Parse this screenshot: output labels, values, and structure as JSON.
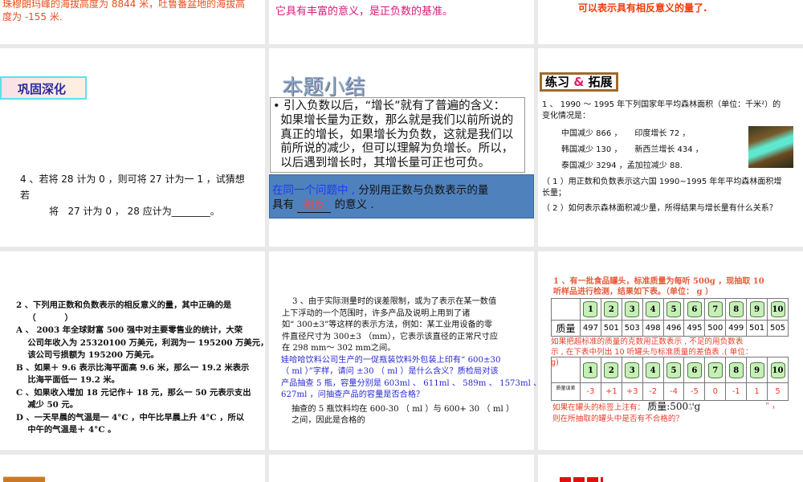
{
  "row1": {
    "left_lines": [
      "珠穆朗玛峰的海拔高度为 8844 米，吐鲁番盆地的海拔高",
      "度为 -155 米."
    ],
    "middle_text": "它具有丰富的意义，是正负数的基准。",
    "right_text": "可以表示具有相反意义的量了."
  },
  "slide_consolidate": {
    "title": "巩固深化",
    "lines": [
      "4 、若将 28 计为 0 ，则可将 27 计为一 1 ，试猜想",
      "若",
      "将   27 计为 0 ， 28 应计为________。"
    ]
  },
  "slide_summary": {
    "title": "本题小结",
    "bullet_lines": [
      "• 引入负数以后，“增长”就有了普遍的含义：",
      "  如果增长量为正数，那么就是我们以前所说的",
      "  真正的增长，如果增长为负数，这就是我们以",
      "  前所说的减少，但可以理解为负增长。所以，",
      "  以后遇到增长时，其增长量可正也可负。"
    ],
    "box_prefix": "在同一个问题中 ,",
    "box_line1": " 分别用正数与负数表示的量",
    "box_line2a": "具有",
    "box_answer": "相反",
    "box_line2b": "的意义 ."
  },
  "slide_practice": {
    "title_a": "练习",
    "title_amp": "&",
    "title_b": "拓展",
    "lines": [
      "1 、 1990 ～ 1995 年下列国家年平均森林面积（单位：千米²）的",
      "变化情况是："
    ],
    "items": [
      "中国减少 866 ，     印度增长 72 ，",
      "韩国减少 130 ，     新西兰增长 434 ，",
      "泰国减少 3294 ，孟加拉减少 88."
    ],
    "q1a": "（ 1 ）用正数和负数表示这六国 1990~1995 年年平均森林面积增",
    "q1b": "长量；",
    "q2": "（ 2 ）如何表示森林面积减少量，所得结果与增长量有什么关系？"
  },
  "slide_q2": {
    "lines": [
      "2 、下列用正数和负数表示的相反意义的量，其中正确的是",
      "    （          ）",
      "A 、 2003 年全球财富 500 强中对主要零售业的统计，大荣",
      "    公司年收入为 25320100 万美元，利润为一 195200 万美元，",
      "    该公司亏损额为 195200 万美元。",
      "B 、如果＋ 9.6 表示比海平面高 9.6 米，那么一 19.2 米表示",
      "    比海平面低一 19.2 米。",
      "C 、如果收入增加 18 元记作＋ 18 元，那么一 50 元表示支出",
      "    减少 50 元。",
      "D 、一天早晨的气温是一 4°C ，中午比早晨上升 4°C ，所以",
      "    中午的气温是＋ 4°C 。"
    ]
  },
  "slide_q3": {
    "black_lines": [
      "    3 、由于实际测量时的误差限制，或为了表示在某一数值",
      "上下浮动的一个范围时，许多产品及说明上用到了诸",
      "如“ 300±3”等这样的表示方法，例如：某工业用设备的零",
      "件直径尺寸为 300±3 （mm），它表示该直径的正常尺寸应",
      "在 298 mm～ 302 mm之间。"
    ],
    "blue_lines": [
      "娃哈哈饮料公司生产的一促瓶装饮料外包装上印有“ 600±30",
      "（ ml ）”字样，请问 ±30 （ ml ）是什么含义？质检局对该",
      "产品抽查 5 瓶，容量分别是 603ml 、 611ml 、 589m 、 1573ml 、",
      "627ml ，问抽查产品的容量是否合格？"
    ],
    "answer_lines": [
      "抽查的 5 瓶饮料均在 600-30 （ ml ）与 600+ 30 （ ml ）",
      "之间，因此是合格的"
    ]
  },
  "slide_cans": {
    "intro": [
      "1 、有一批食品罐头，标准质量为每听 500g ，现抽取 10",
      "听样品进行检测，结果如下表。（单位： g ）"
    ],
    "can_labels": [
      "1",
      "2",
      "3",
      "4",
      "5",
      "6",
      "7",
      "8",
      "9",
      "10"
    ],
    "mass_label": "质量",
    "masses": [
      "497",
      "501",
      "503",
      "498",
      "496",
      "495",
      "500",
      "499",
      "501",
      "505"
    ],
    "mid": [
      "如果把超标准的质量的克数用正数表示 , 不足的用负数表",
      "示 , 在下表中列出 10 听罐头与标准质量的差值表 .( 单位：",
      "g)"
    ],
    "error_label": "质量误差",
    "errors": [
      "-3",
      "+1",
      "+3",
      "-2",
      "-4",
      "-5",
      "0",
      "-1",
      "1",
      "5"
    ],
    "q_a": "如果在罐头的标签上注有：",
    "q_formula": "质量:500",
    "q_sup": "+4",
    "q_sub": "-3",
    "q_unit": "g",
    "q_close": "” ，",
    "q_b": "则在所抽取的罐头中是否有不合格的？"
  }
}
